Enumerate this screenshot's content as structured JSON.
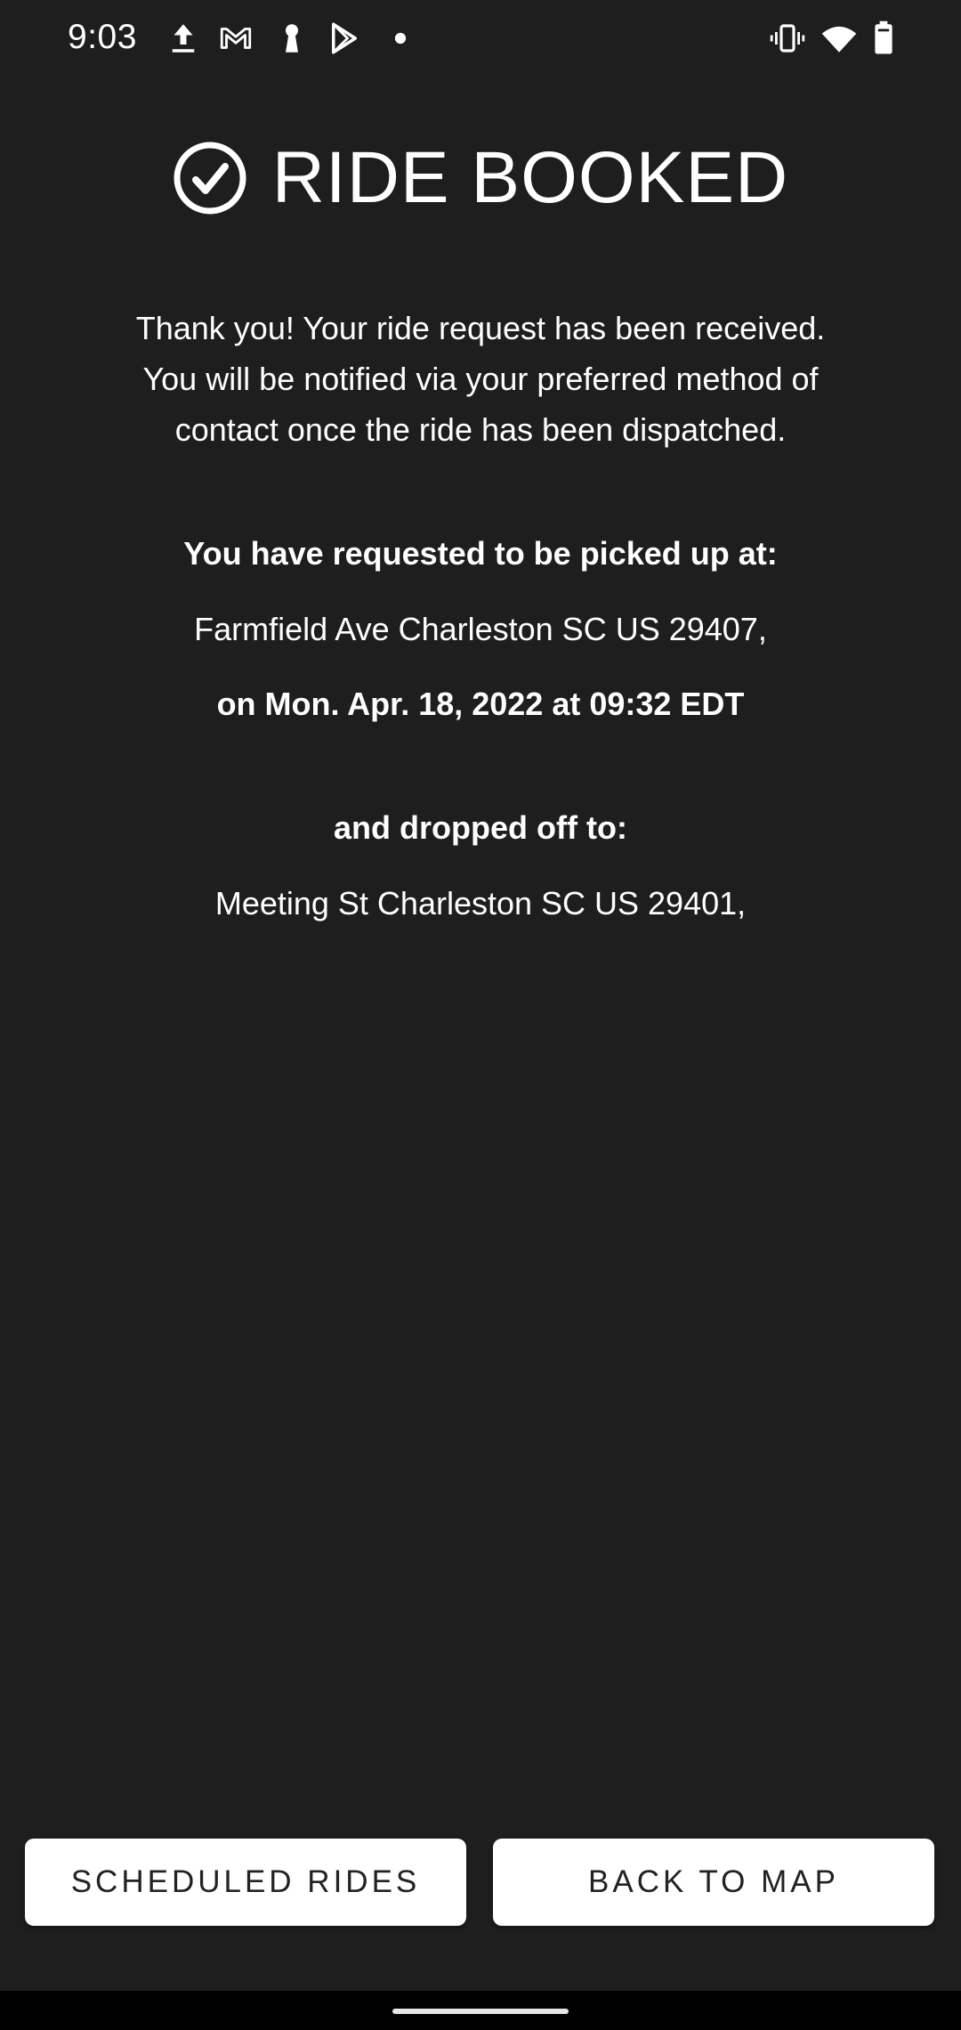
{
  "status_bar": {
    "time": "9:03",
    "left_icons": [
      "upload-icon",
      "gmail-icon",
      "keyhole-icon",
      "play-store-icon",
      "notification-dot-icon"
    ],
    "right_icons": [
      "vibrate-icon",
      "wifi-icon",
      "battery-icon"
    ]
  },
  "header": {
    "icon": "check-circle-icon",
    "title": "RIDE BOOKED"
  },
  "message": {
    "intro_line1": "Thank you! Your ride request has been received.",
    "intro_line2": "You will be notified via your preferred method of",
    "intro_line3": "contact once the ride has been dispatched."
  },
  "pickup": {
    "label": "You have requested to be picked up at:",
    "address": "Farmfield Ave Charleston SC US 29407,",
    "datetime": "on Mon. Apr. 18, 2022 at 09:32 EDT"
  },
  "dropoff": {
    "label": "and dropped off to:",
    "address": "Meeting St Charleston SC US 29401,"
  },
  "actions": {
    "scheduled_rides_label": "SCHEDULED RIDES",
    "back_to_map_label": "BACK TO MAP"
  },
  "colors": {
    "background": "#1e1e1e",
    "text": "#ffffff",
    "button_bg": "#ffffff",
    "button_text": "#222222",
    "nav_bar": "#000000"
  }
}
